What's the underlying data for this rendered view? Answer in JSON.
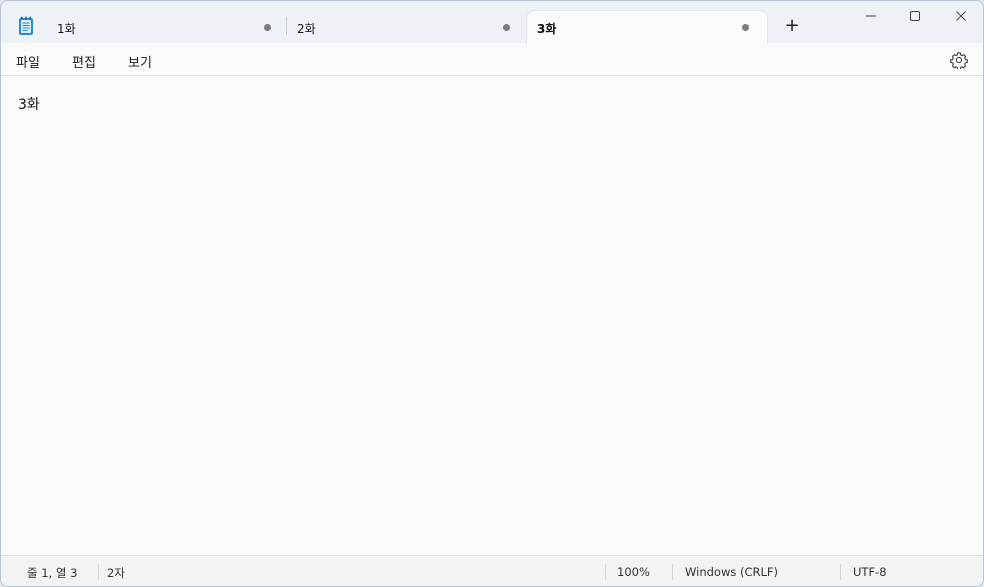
{
  "tabs": [
    {
      "label": "1화",
      "modified": true
    },
    {
      "label": "2화",
      "modified": true
    },
    {
      "label": "3화",
      "modified": true,
      "active": true
    }
  ],
  "new_tab_label": "+",
  "menu": {
    "file": "파일",
    "edit": "편집",
    "view": "보기"
  },
  "editor": {
    "content": "3화"
  },
  "status": {
    "position": "줄 1, 열 3",
    "char_count": "2자",
    "zoom": "100%",
    "line_ending": "Windows (CRLF)",
    "encoding": "UTF-8"
  },
  "colors": {
    "accent": "#1f7ac4",
    "background": "#fafafa",
    "titlebar": "#eef1f5"
  }
}
